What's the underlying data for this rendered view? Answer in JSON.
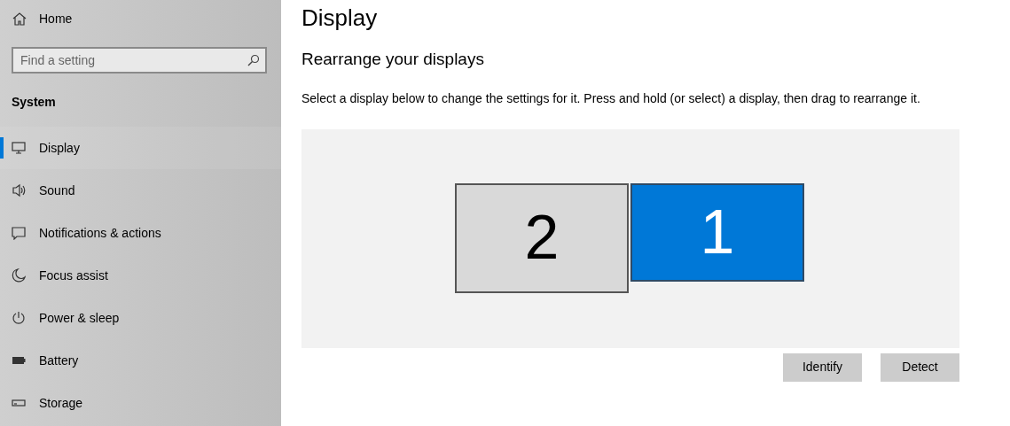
{
  "sidebar": {
    "home": "Home",
    "search": {
      "placeholder": "Find a setting"
    },
    "section": "System",
    "items": [
      {
        "label": "Display",
        "selected": true
      },
      {
        "label": "Sound",
        "selected": false
      },
      {
        "label": "Notifications & actions",
        "selected": false
      },
      {
        "label": "Focus assist",
        "selected": false
      },
      {
        "label": "Power & sleep",
        "selected": false
      },
      {
        "label": "Battery",
        "selected": false
      },
      {
        "label": "Storage",
        "selected": false
      }
    ]
  },
  "page": {
    "title": "Display",
    "heading": "Rearrange your displays",
    "description": "Select a display below to change the settings for it. Press and hold (or select) a display, then drag to rearrange it.",
    "displays": [
      {
        "label": "2",
        "selected": false
      },
      {
        "label": "1",
        "selected": true
      }
    ],
    "buttons": [
      "Identify",
      "Detect"
    ]
  }
}
